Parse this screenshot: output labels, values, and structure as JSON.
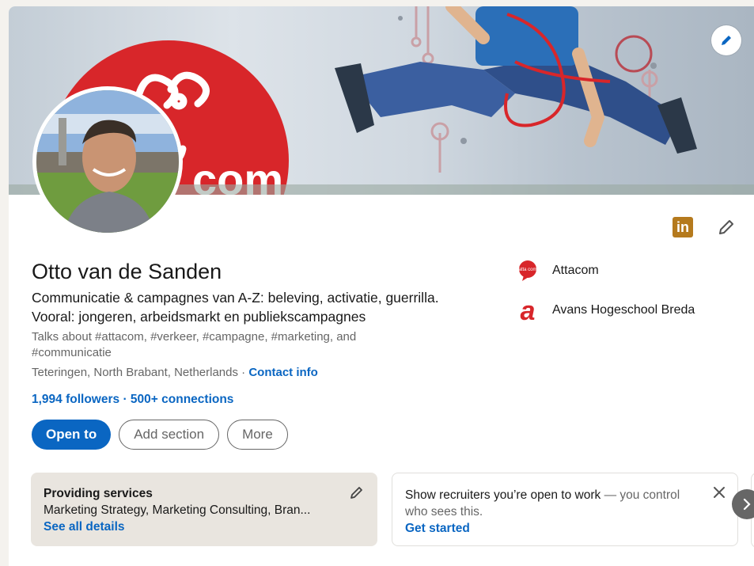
{
  "profile": {
    "name": "Otto van de Sanden",
    "headline_line1": "Communicatie & campagnes van A-Z: beleving, activatie, guerrilla.",
    "headline_line2": "Vooral: jongeren, arbeidsmarkt en publiekscampagnes",
    "talks_about": "Talks about #attacom, #verkeer, #campagne, #marketing, and #communicatie",
    "location": "Teteringen, North Brabant, Netherlands",
    "location_sep": " · ",
    "contact_info": "Contact info",
    "followers": "1,994 followers",
    "network_sep": " · ",
    "connections": "500+ connections"
  },
  "buttons": {
    "open_to": "Open to",
    "add_section": "Add section",
    "more": "More"
  },
  "companies": [
    {
      "name": "Attacom",
      "logo_icon": "attacom-logo-icon",
      "logo_text": "atta com"
    },
    {
      "name": "Avans Hogeschool Breda",
      "logo_icon": "avans-logo-icon",
      "logo_text": "a"
    }
  ],
  "top_icons": {
    "linkedin_badge": "in"
  },
  "services_card": {
    "title": "Providing services",
    "body": "Marketing Strategy, Marketing Consulting, Bran...",
    "link": "See all details"
  },
  "recruiter_card": {
    "text_main": "Show recruiters you’re open to work",
    "text_muted": " — you control who sees this.",
    "link": "Get started"
  },
  "banner": {
    "logo_text": "com"
  },
  "colors": {
    "brand_blue": "#0a66c2",
    "attacom_red": "#d8262a",
    "linkedin_badge": "#b57a1d",
    "services_bg": "#e9e5df"
  }
}
